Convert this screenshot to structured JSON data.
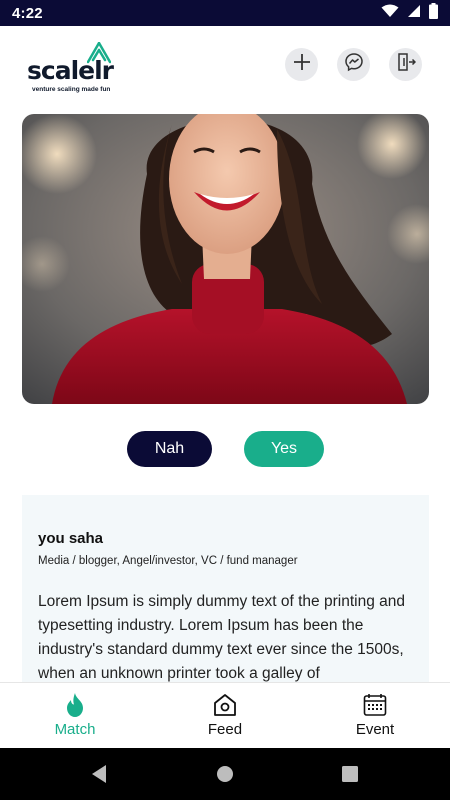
{
  "status_bar": {
    "time": "4:22"
  },
  "brand": {
    "name": "scalelr",
    "tagline": "venture scaling made fun",
    "color": "#19ae8b"
  },
  "header_actions": [
    "add-icon",
    "messenger-icon",
    "logout-icon"
  ],
  "actions": {
    "nah_label": "Nah",
    "yes_label": "Yes"
  },
  "profile": {
    "name": "you saha",
    "roles": "Media / blogger, Angel/investor, VC / fund manager",
    "bio": "Lorem Ipsum is simply dummy text of the printing and typesetting industry. Lorem Ipsum has been the industry's standard dummy text ever since the 1500s, when an unknown printer took a galley of"
  },
  "bottom_nav": {
    "items": [
      {
        "label": "Match",
        "icon": "flame-icon",
        "active": true
      },
      {
        "label": "Feed",
        "icon": "home-camera-icon",
        "active": false
      },
      {
        "label": "Event",
        "icon": "calendar-icon",
        "active": false
      }
    ]
  },
  "colors": {
    "navy": "#0b0b36",
    "accent": "#19ae8b",
    "card_bg": "#f3f8fa"
  }
}
